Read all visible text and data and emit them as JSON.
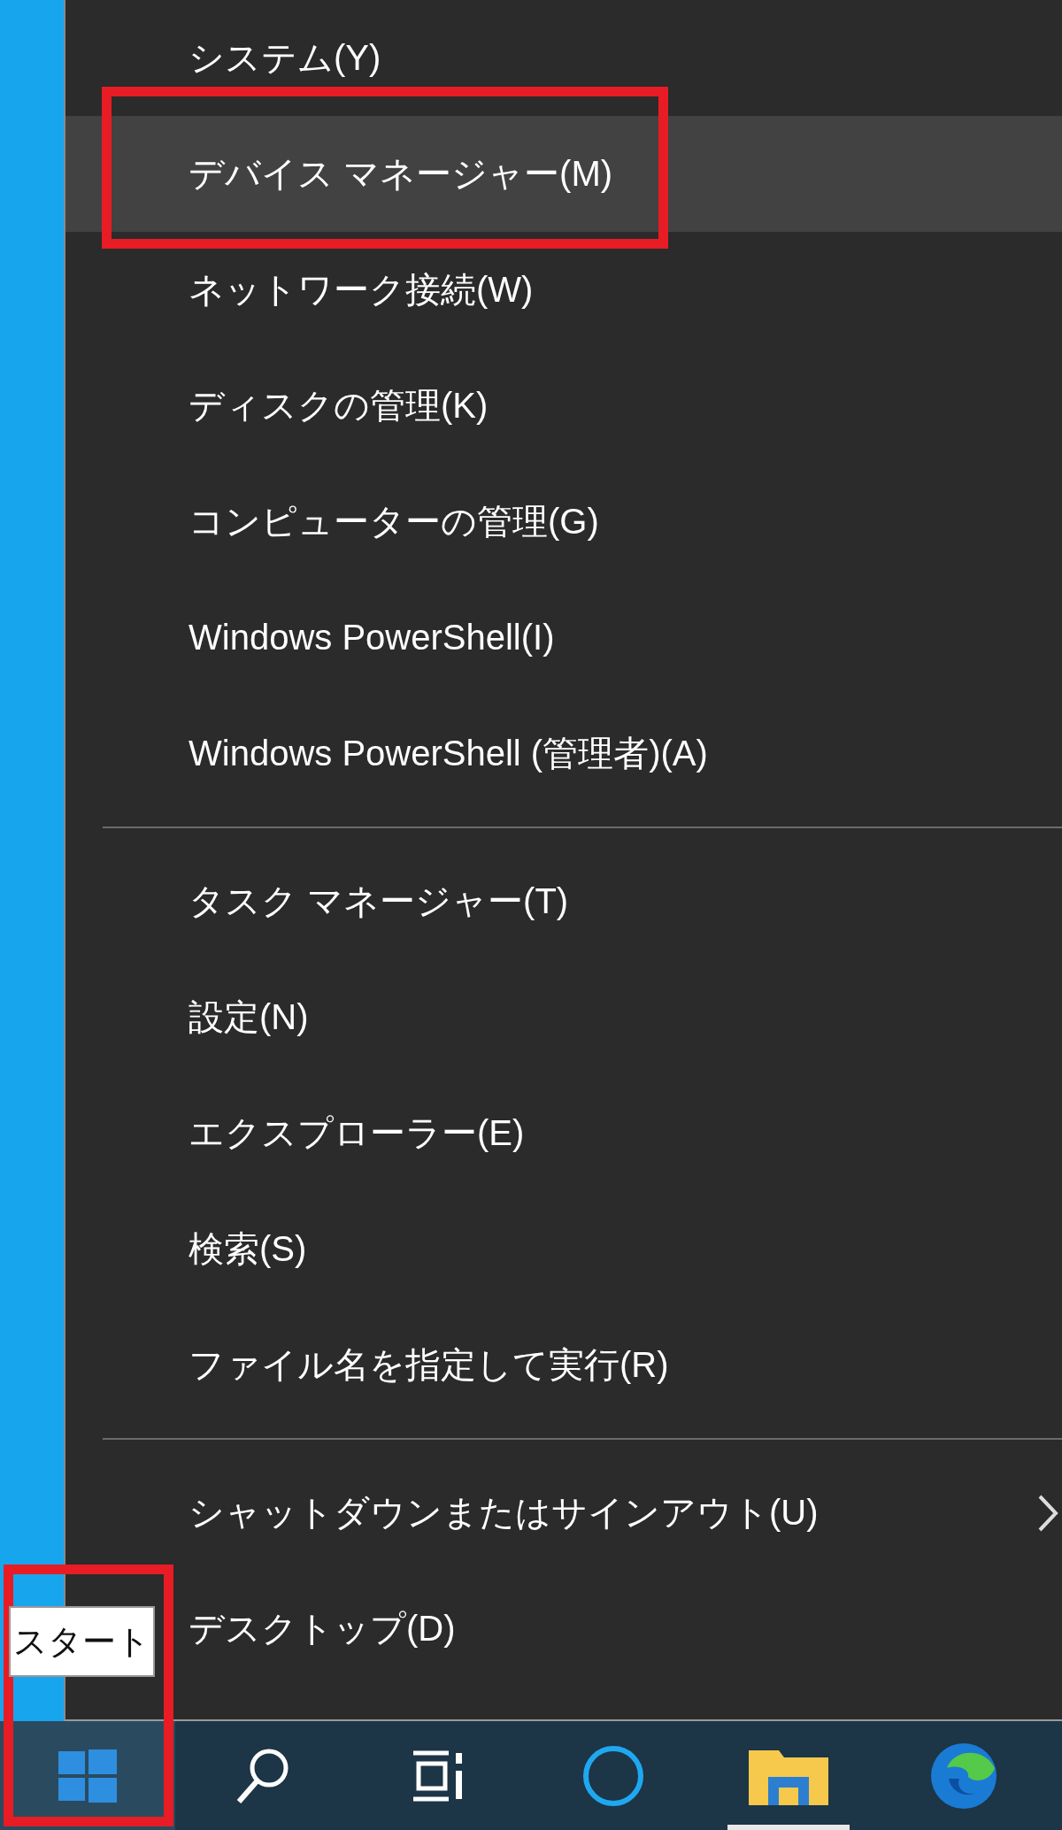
{
  "menu": {
    "sections": [
      {
        "items": [
          {
            "label": "システム(Y)",
            "selected": false,
            "marked": false,
            "submenu": false
          },
          {
            "label": "デバイス マネージャー(M)",
            "selected": true,
            "marked": true,
            "submenu": false
          },
          {
            "label": "ネットワーク接続(W)",
            "selected": false,
            "marked": false,
            "submenu": false
          },
          {
            "label": "ディスクの管理(K)",
            "selected": false,
            "marked": false,
            "submenu": false
          },
          {
            "label": "コンピューターの管理(G)",
            "selected": false,
            "marked": false,
            "submenu": false
          },
          {
            "label": "Windows PowerShell(I)",
            "selected": false,
            "marked": false,
            "submenu": false
          },
          {
            "label": "Windows PowerShell (管理者)(A)",
            "selected": false,
            "marked": false,
            "submenu": false
          }
        ]
      },
      {
        "items": [
          {
            "label": "タスク マネージャー(T)",
            "selected": false,
            "marked": false,
            "submenu": false
          },
          {
            "label": "設定(N)",
            "selected": false,
            "marked": false,
            "submenu": false
          },
          {
            "label": "エクスプローラー(E)",
            "selected": false,
            "marked": false,
            "submenu": false
          },
          {
            "label": "検索(S)",
            "selected": false,
            "marked": false,
            "submenu": false
          },
          {
            "label": "ファイル名を指定して実行(R)",
            "selected": false,
            "marked": false,
            "submenu": false
          }
        ]
      },
      {
        "items": [
          {
            "label": "シャットダウンまたはサインアウト(U)",
            "selected": false,
            "marked": false,
            "submenu": true
          },
          {
            "label": "デスクトップ(D)",
            "selected": false,
            "marked": false,
            "submenu": false
          }
        ]
      }
    ]
  },
  "tooltip": {
    "text": "スタート"
  },
  "taskbar": {
    "buttons": [
      {
        "kind": "start",
        "selected": true,
        "marked": true,
        "running": false
      },
      {
        "kind": "search",
        "selected": false,
        "marked": false,
        "running": false
      },
      {
        "kind": "taskview",
        "selected": false,
        "marked": false,
        "running": false
      },
      {
        "kind": "cortana",
        "selected": false,
        "marked": false,
        "running": false
      },
      {
        "kind": "explorer",
        "selected": false,
        "marked": false,
        "running": true
      },
      {
        "kind": "edge",
        "selected": false,
        "marked": false,
        "running": false
      }
    ]
  }
}
